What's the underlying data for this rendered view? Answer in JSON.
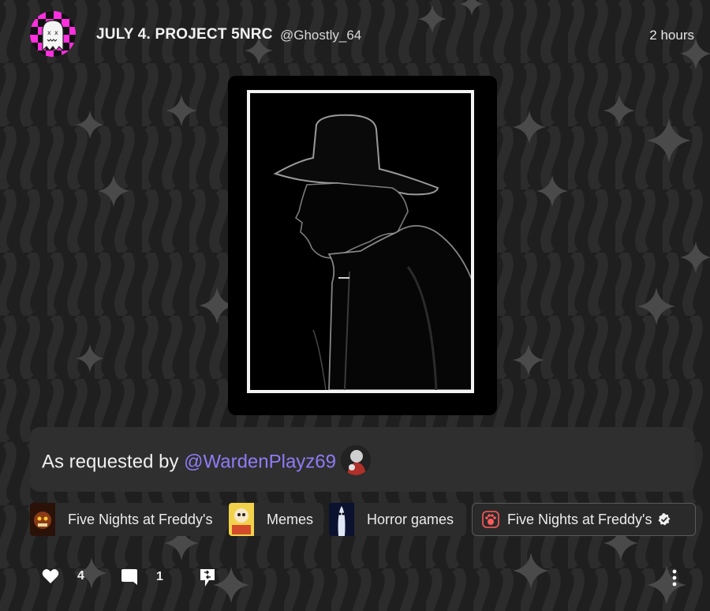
{
  "post": {
    "title": "JULY 4. PROJECT 5NRC",
    "handle": "@Ghostly_64",
    "time": "2 hours"
  },
  "caption": {
    "text": "As requested by ",
    "mention": "@WardenPlayz69"
  },
  "tags": [
    {
      "label": "Five Nights at Freddy's",
      "icon": "fnaf-thumbnail"
    },
    {
      "label": "Memes",
      "icon": "memes-thumbnail"
    },
    {
      "label": "Horror games",
      "icon": "horror-thumbnail"
    },
    {
      "label": "Five Nights at Freddy's",
      "icon": "paw-icon",
      "verified": true
    }
  ],
  "actions": {
    "likes": "4",
    "comments": "1"
  },
  "colors": {
    "background": "#1e1e1e",
    "mention": "#8f7cf7",
    "card": "#2f2f2f"
  }
}
